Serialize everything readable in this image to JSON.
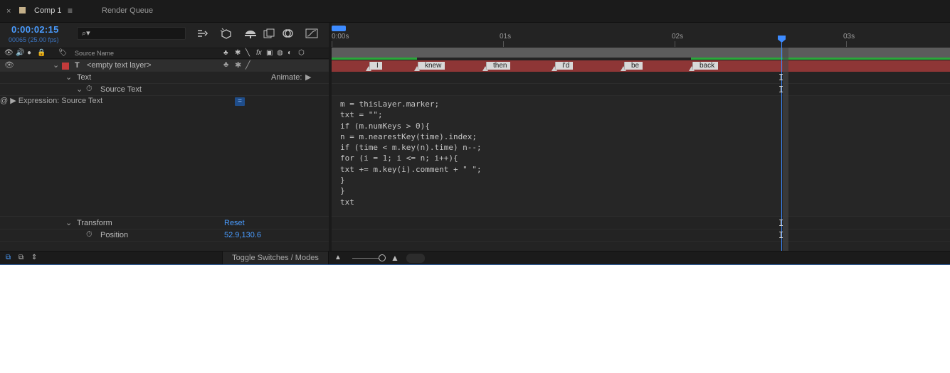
{
  "tabs": [
    {
      "close": "×",
      "title": "Comp 1",
      "menu": "≡"
    },
    {
      "title": "Render Queue"
    }
  ],
  "header": {
    "timecode": "0:00:02:15",
    "frames": "00065 (25.00 fps)",
    "search_glyph": "⌕▾",
    "source_name_label": "Source Name"
  },
  "layer": {
    "type_glyph": "T",
    "name": "<empty text layer>",
    "color": "#c23b3b"
  },
  "properties": {
    "text_group": "Text",
    "animate_label": "Animate:",
    "source_text": "Source Text",
    "expression_label": "Expression: Source Text",
    "transform_group": "Transform",
    "reset_label": "Reset",
    "position_label": "Position",
    "position_value": "52.9,130.6"
  },
  "ruler": {
    "labels": [
      "0:00s",
      "01s",
      "02s",
      "03s"
    ]
  },
  "markers": [
    "I",
    "knew",
    "then",
    "I'd",
    "be",
    "back"
  ],
  "expression_code": "m = thisLayer.marker;\ntxt = \"\";\nif (m.numKeys > 0){\nn = m.nearestKey(time).index;\nif (time < m.key(n).time) n--;\nfor (i = 1; i <= n; i++){\ntxt += m.key(i).comment + \" \";\n}\n}\ntxt",
  "bottom": {
    "toggle_label": "Toggle Switches / Modes"
  },
  "colors": {
    "accent": "#4a9cff",
    "layer_bar": "#8e3636",
    "marker": "#d8d8d8",
    "in_out_line": "#2aa83a"
  }
}
